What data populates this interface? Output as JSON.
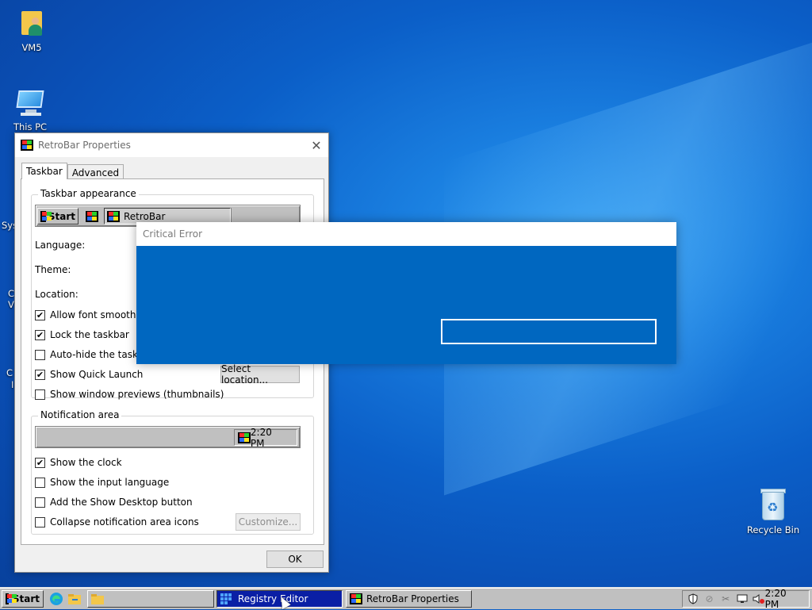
{
  "desktop": {
    "icons": [
      {
        "label": "VM5"
      },
      {
        "label": "This PC"
      },
      {
        "label": "Recycle Bin"
      }
    ],
    "edge_labels": [
      "Sys",
      "C",
      "V",
      "C",
      "I"
    ]
  },
  "properties_window": {
    "title": "RetroBar Properties",
    "tabs": [
      {
        "label": "Taskbar"
      },
      {
        "label": "Advanced"
      }
    ],
    "taskbar_group": {
      "title": "Taskbar appearance",
      "preview_start": "Start",
      "preview_app": "RetroBar",
      "language_label": "Language:",
      "theme_label": "Theme:",
      "location_label": "Location:",
      "checkboxes": [
        {
          "label": "Allow font smoothing",
          "checked": true
        },
        {
          "label": "Lock the taskbar",
          "checked": true
        },
        {
          "label": "Auto-hide the taskbar",
          "checked": false
        },
        {
          "label": "Show Quick Launch",
          "checked": true
        },
        {
          "label": "Show window previews (thumbnails)",
          "checked": false
        }
      ],
      "select_location_label": "Select location..."
    },
    "notification_group": {
      "title": "Notification area",
      "preview_clock": "2:20 PM",
      "checkboxes": [
        {
          "label": "Show the clock",
          "checked": true
        },
        {
          "label": "Show the input language",
          "checked": false
        },
        {
          "label": "Add the Show Desktop button",
          "checked": false
        },
        {
          "label": "Collapse notification area icons",
          "checked": false
        }
      ],
      "customize_label": "Customize..."
    },
    "ok_label": "OK"
  },
  "critical_dialog": {
    "title": "Critical Error"
  },
  "taskbar": {
    "start_label": "Start",
    "buttons": [
      {
        "label": ""
      },
      {
        "label": "Registry Editor",
        "active": true
      },
      {
        "label": "RetroBar Properties",
        "active": false
      }
    ],
    "clock": "2:20 PM"
  },
  "colors": {
    "dialog_blue": "#0067c0",
    "active_task": "#0a1fa5",
    "taskbar_gray": "#c0c0c0"
  }
}
